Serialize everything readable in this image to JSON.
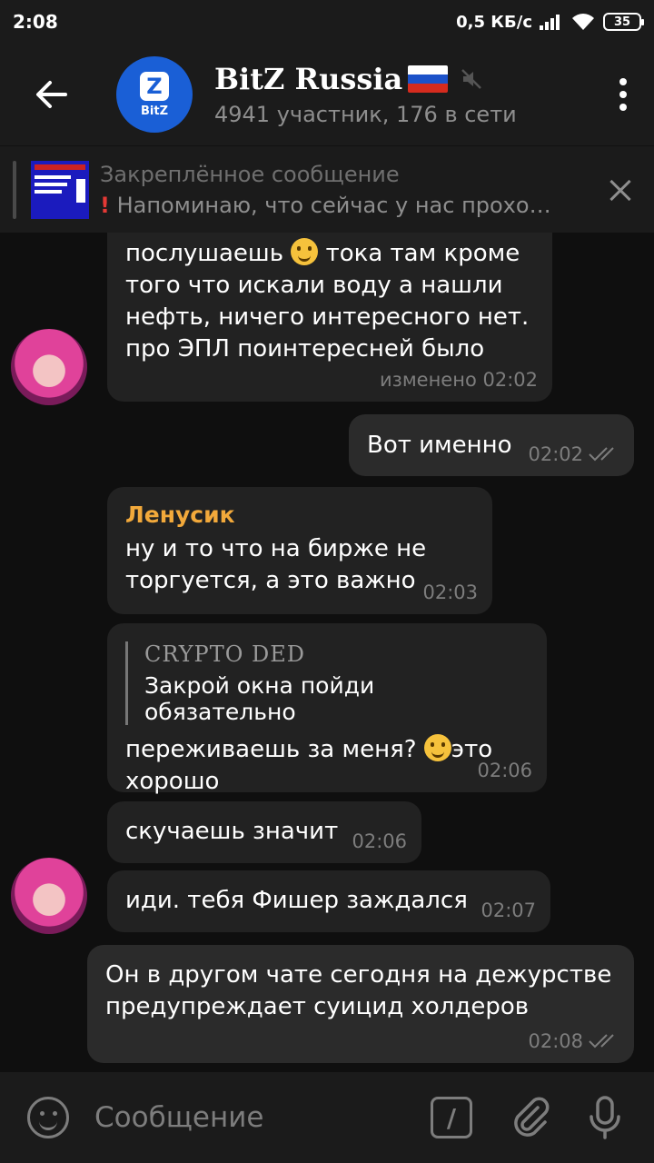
{
  "status": {
    "time": "2:08",
    "speed": "0,5 КБ/с",
    "battery": "35"
  },
  "header": {
    "title": "BitZ Russia",
    "subtitle": "4941 участник, 176 в сети",
    "avatar_label": "BitZ",
    "avatar_letter": "Z"
  },
  "pinned": {
    "title": "Закреплённое сообщение",
    "excl": "!",
    "message": " Напоминаю, что сейчас у нас прохо…"
  },
  "messages": [
    {
      "lines": [
        "послушаешь",
        "тока там кроме",
        "того что искали воду а нашли",
        "нефть, ничего интересного нет.",
        "про ЭПЛ поинтересней было"
      ],
      "time": "изменено 02:02"
    },
    {
      "text": "Вот именно",
      "time": "02:02"
    },
    {
      "sender": "Ленусик",
      "lines": [
        "ну и то что на бирже не",
        "торгуется, а это важно"
      ],
      "time": "02:03"
    },
    {
      "reply_name": "CRYPTO DED",
      "reply_text": "Закрой окна пойди обязательно",
      "line1a": "переживаешь за меня?",
      "line1b": "это",
      "line2": "хорошо",
      "time": "02:06"
    },
    {
      "text": "скучаешь значит",
      "time": "02:06"
    },
    {
      "text": "иди. тебя Фишер заждался",
      "time": "02:07"
    },
    {
      "lines": [
        "Он в другом чате сегодня на дежурстве",
        "предупреждает суицид холдеров"
      ],
      "time": "02:08"
    }
  ],
  "input": {
    "placeholder": "Сообщение"
  },
  "colors": {
    "accent": "#f2a93b",
    "brand": "#1a5fd6"
  }
}
